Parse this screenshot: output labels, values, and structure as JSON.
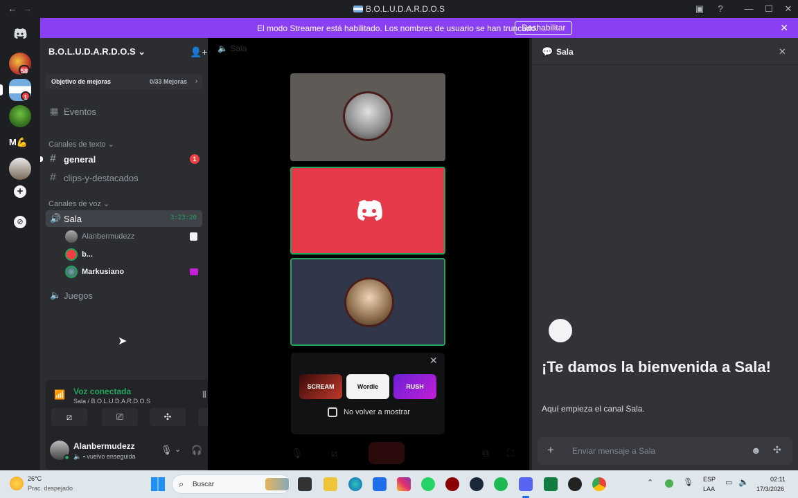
{
  "titlebar": {
    "back": "←",
    "forward": "→",
    "title": "B.O.L.U.D.A.R.D.O.S",
    "inbox_icon": "inbox-icon",
    "help_icon": "help-icon",
    "minimize": "—",
    "maximize": "☐",
    "close": "✕"
  },
  "banner": {
    "message": "El modo Streamer está habilitado. Los nombres de usuario se han truncado.",
    "button": "Deshabilitar",
    "close": "✕"
  },
  "rail": {
    "badges": [
      "58",
      "1"
    ],
    "add": "+",
    "discover": "⊘"
  },
  "sidebar": {
    "server_name": "B.O.L.U.D.A.R.D.O.S",
    "boost_label": "Objetivo de mejoras",
    "boost_value": "0/33 Mejoras",
    "events": "Eventos",
    "text_category": "Canales de texto",
    "text_channels": [
      {
        "name": "general",
        "badge": "1"
      },
      {
        "name": "clips-y-destacados"
      }
    ],
    "voice_category": "Canales de voz",
    "voice_channels": [
      {
        "name": "Sala",
        "timer": "3:23:20"
      },
      {
        "name": "Juegos"
      }
    ],
    "members": [
      "Alanbermudezz",
      "b...",
      "Markusiano"
    ]
  },
  "voice_panel": {
    "status": "Voz conectada",
    "location": "Sala / B.O.L.U.D.A.R.D.O.S",
    "username": "Alanbermudezz",
    "user_status": "vuelvo enseguida"
  },
  "voice_area": {
    "header": "Sala",
    "activities": [
      "SCREAM",
      "Wordle",
      "RUSH"
    ],
    "dont_show_again": "No volver a mostrar"
  },
  "chat": {
    "title": "Sala",
    "welcome_heading": "¡Te damos la bienvenida a Sala!",
    "welcome_sub": "Aquí empieza el canal Sala.",
    "input_placeholder": "Enviar mensaje a Sala"
  },
  "taskbar": {
    "weather_temp": "26°C",
    "weather_desc": "Prac. despejado",
    "search_placeholder": "Buscar",
    "lang_1": "ESP",
    "lang_2": "LAA",
    "time": "02:11",
    "date": "17/3/2026"
  },
  "colors": {
    "accent": "#5865f2",
    "streamer_banner": "#8a3ff2",
    "voice_green": "#23a55a",
    "tile_red": "#e6394a"
  }
}
